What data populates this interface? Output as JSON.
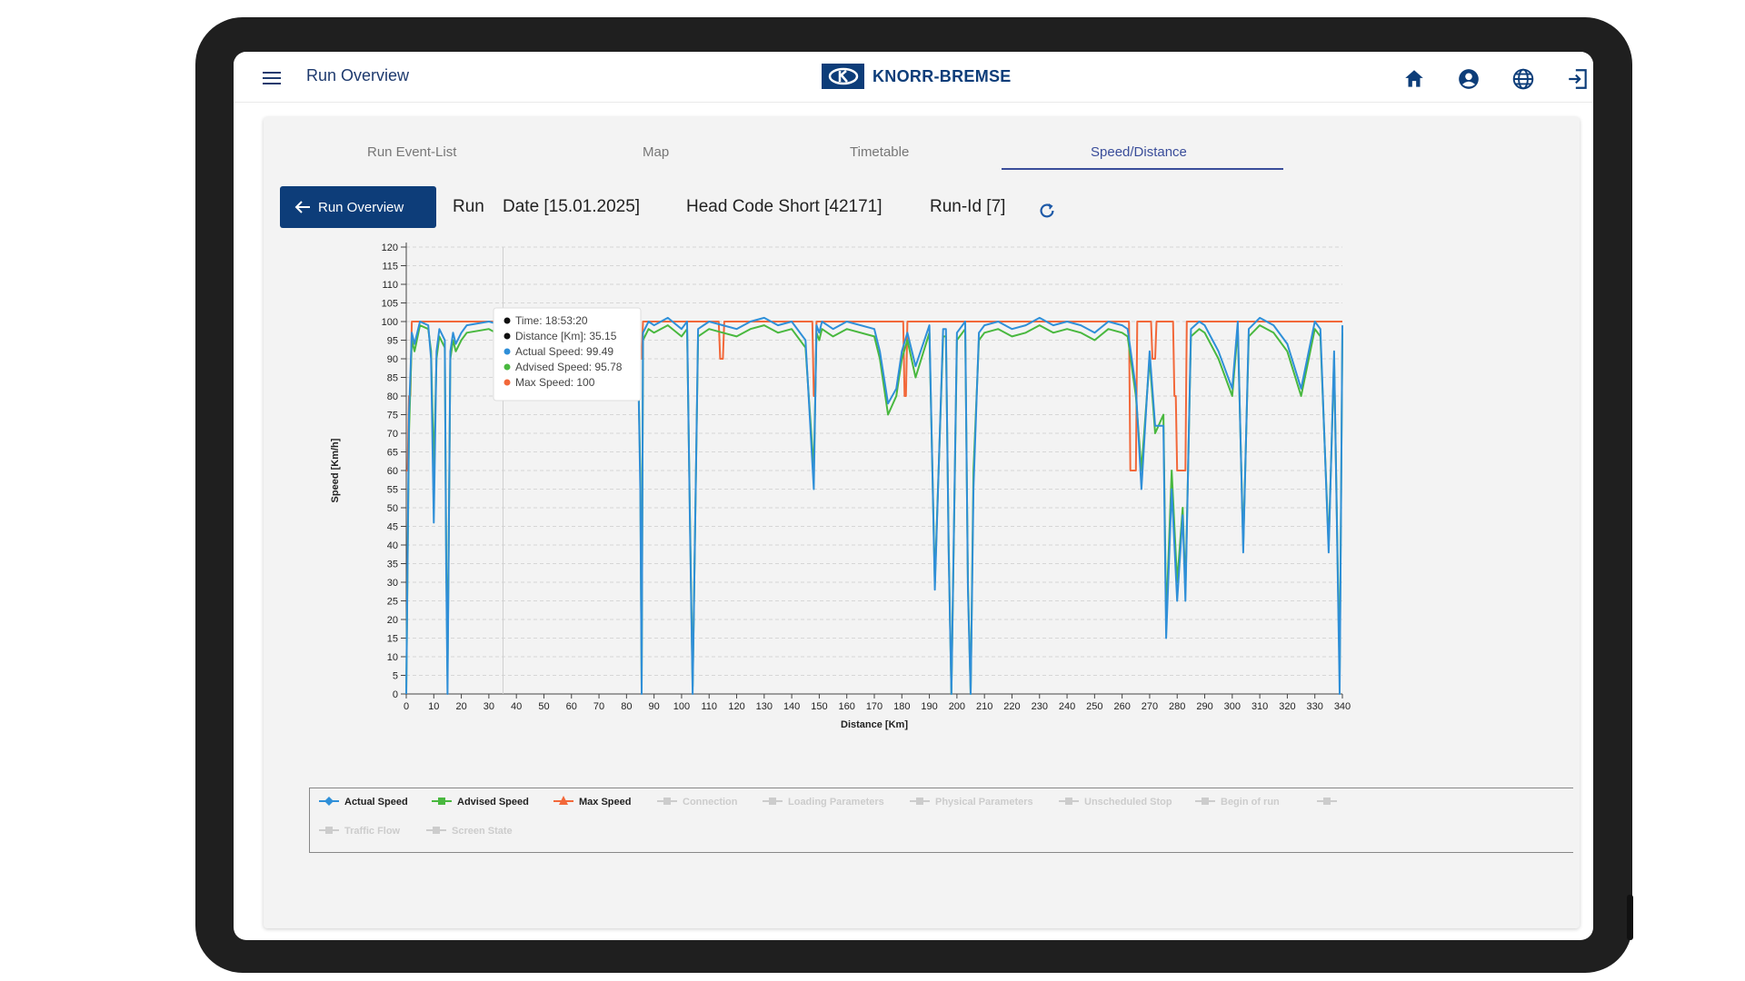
{
  "header": {
    "title": "Run Overview",
    "logo_text": "KNORR-BREMSE"
  },
  "tabs": [
    {
      "label": "Run Event-List"
    },
    {
      "label": "Map"
    },
    {
      "label": "Timetable"
    },
    {
      "label": "Speed/Distance",
      "active": true
    }
  ],
  "back_button": {
    "label": "Run Overview"
  },
  "run_info": {
    "run": "Run",
    "date": "Date [15.01.2025]",
    "head_code": "Head Code Short [42171]",
    "run_id": "Run-Id [7]"
  },
  "colors": {
    "brand": "#0d3d79",
    "actual": "#2f8fd8",
    "advised": "#49b83f",
    "max": "#f2683a"
  },
  "tooltip": {
    "time": "Time: 18:53:20",
    "distance": "Distance [Km]: 35.15",
    "actual": "Actual Speed: 99.49",
    "advised": "Advised Speed: 95.78",
    "max": "Max Speed: 100"
  },
  "legend": [
    {
      "label": "Actual Speed",
      "active": true,
      "marker": "diamond"
    },
    {
      "label": "Advised Speed",
      "active": true,
      "marker": "square"
    },
    {
      "label": "Max Speed",
      "active": true,
      "marker": "triangle"
    },
    {
      "label": "Connection",
      "active": false,
      "marker": "square"
    },
    {
      "label": "Loading Parameters",
      "active": false,
      "marker": "square"
    },
    {
      "label": "Physical Parameters",
      "active": false,
      "marker": "square"
    },
    {
      "label": "Unscheduled Stop",
      "active": false,
      "marker": "square"
    },
    {
      "label": "Begin of run",
      "active": false,
      "marker": "square"
    },
    {
      "label": "",
      "active": false,
      "marker": "square"
    },
    {
      "label": "Traffic Flow",
      "active": false,
      "marker": "square"
    },
    {
      "label": "Screen State",
      "active": false,
      "marker": "square"
    }
  ],
  "chart_data": {
    "type": "line",
    "xlabel": "Distance [Km]",
    "ylabel": "Speed [Km/h]",
    "xlim": [
      0,
      340
    ],
    "ylim": [
      0,
      120
    ],
    "x_ticks": [
      0,
      10,
      20,
      30,
      40,
      50,
      60,
      70,
      80,
      90,
      100,
      110,
      120,
      130,
      140,
      150,
      160,
      170,
      180,
      190,
      200,
      210,
      220,
      230,
      240,
      250,
      260,
      270,
      280,
      290,
      300,
      310,
      320,
      330,
      340
    ],
    "y_ticks": [
      0,
      5,
      10,
      15,
      20,
      25,
      30,
      35,
      40,
      45,
      50,
      55,
      60,
      65,
      70,
      75,
      80,
      85,
      90,
      95,
      100,
      105,
      110,
      115,
      120
    ],
    "grid": true,
    "series": [
      {
        "name": "Max Speed",
        "color": "#f2683a",
        "x": [
          0,
          0.5,
          1,
          1.5,
          2,
          2.5,
          3,
          84,
          84.5,
          85,
          85.5,
          86,
          113,
          113.5,
          114,
          115,
          115.5,
          116,
          147,
          147.5,
          148,
          148.5,
          149,
          149.5,
          180,
          180.5,
          181,
          181.5,
          182,
          182.5,
          262,
          262.5,
          263,
          265,
          265.5,
          266,
          270,
          270.5,
          271,
          272,
          272.5,
          273,
          278,
          278.5,
          279,
          279.5,
          280,
          283,
          283.5,
          284,
          285,
          285.5,
          286,
          340
        ],
        "y": [
          60,
          60,
          80,
          80,
          100,
          100,
          100,
          100,
          100,
          90,
          90,
          100,
          100,
          100,
          90,
          90,
          100,
          100,
          100,
          100,
          80,
          80,
          100,
          100,
          100,
          100,
          80,
          80,
          100,
          100,
          100,
          100,
          60,
          60,
          100,
          100,
          100,
          100,
          90,
          90,
          100,
          100,
          100,
          100,
          80,
          80,
          60,
          60,
          100,
          100,
          100,
          100,
          100,
          100
        ]
      },
      {
        "name": "Advised Speed",
        "color": "#49b83f",
        "x": [
          0,
          1,
          2,
          3,
          5,
          8,
          9,
          10,
          11,
          12,
          14,
          14.5,
          15,
          16,
          17,
          18,
          20,
          22,
          30,
          35,
          40,
          45,
          50,
          55,
          60,
          65,
          70,
          80,
          84,
          85,
          85.5,
          86,
          88,
          90,
          95,
          100,
          102,
          103,
          104,
          106,
          110,
          115,
          120,
          125,
          130,
          135,
          140,
          145,
          148,
          149,
          150,
          151,
          153,
          155,
          160,
          170,
          172,
          175,
          178,
          180,
          182,
          185,
          190,
          192,
          195,
          196,
          197,
          198,
          200,
          203,
          204,
          205,
          206,
          208,
          210,
          215,
          220,
          225,
          230,
          235,
          240,
          245,
          250,
          255,
          260,
          262,
          265,
          267,
          270,
          272,
          275,
          276,
          278,
          280,
          282,
          283,
          285,
          288,
          290,
          295,
          300,
          302,
          304,
          306,
          310,
          315,
          320,
          325,
          330,
          332,
          335,
          337,
          339,
          340
        ],
        "y": [
          0,
          70,
          95,
          92,
          99,
          98,
          92,
          60,
          90,
          96,
          93,
          40,
          5,
          90,
          95,
          92,
          95,
          97,
          98,
          96,
          99,
          98,
          97,
          96,
          98,
          97,
          95,
          97,
          96,
          60,
          2,
          95,
          98,
          97,
          99,
          96,
          98,
          50,
          2,
          96,
          98,
          97,
          96,
          98,
          99,
          97,
          98,
          93,
          60,
          97,
          95,
          98,
          97,
          96,
          98,
          96,
          90,
          75,
          80,
          90,
          95,
          85,
          97,
          30,
          96,
          96,
          40,
          0,
          95,
          98,
          30,
          0,
          60,
          95,
          97,
          98,
          96,
          97,
          99,
          97,
          98,
          97,
          95,
          98,
          97,
          96,
          80,
          60,
          90,
          70,
          75,
          20,
          60,
          30,
          50,
          28,
          96,
          98,
          97,
          90,
          80,
          98,
          40,
          96,
          99,
          97,
          92,
          80,
          98,
          96,
          40,
          90,
          5,
          97
        ]
      },
      {
        "name": "Actual Speed",
        "color": "#2f8fd8",
        "x": [
          0,
          1,
          2,
          3,
          5,
          8,
          9,
          10,
          11,
          12,
          14,
          14.5,
          15,
          16,
          17,
          18,
          20,
          22,
          30,
          35,
          40,
          45,
          50,
          55,
          60,
          65,
          70,
          80,
          84,
          85,
          85.5,
          86,
          88,
          90,
          95,
          100,
          102,
          103,
          104,
          106,
          110,
          115,
          120,
          125,
          130,
          135,
          140,
          145,
          148,
          149,
          150,
          151,
          153,
          155,
          160,
          170,
          172,
          175,
          178,
          180,
          182,
          185,
          190,
          192,
          195,
          196,
          197,
          198,
          200,
          203,
          204,
          205,
          206,
          208,
          210,
          215,
          220,
          225,
          230,
          235,
          240,
          245,
          250,
          255,
          260,
          262,
          265,
          267,
          270,
          272,
          275,
          276,
          278,
          280,
          282,
          283,
          285,
          288,
          290,
          295,
          300,
          302,
          304,
          306,
          310,
          315,
          320,
          325,
          330,
          332,
          335,
          337,
          339,
          340
        ],
        "y": [
          0,
          75,
          97,
          94,
          100,
          99,
          90,
          46,
          92,
          98,
          95,
          35,
          0,
          92,
          97,
          94,
          97,
          99,
          100,
          99,
          101,
          100,
          99,
          98,
          100,
          99,
          97,
          99,
          98,
          55,
          0,
          97,
          100,
          99,
          101,
          98,
          100,
          48,
          0,
          98,
          100,
          99,
          98,
          100,
          101,
          99,
          100,
          95,
          55,
          99,
          97,
          100,
          99,
          98,
          100,
          98,
          92,
          78,
          82,
          92,
          97,
          88,
          99,
          28,
          98,
          98,
          38,
          0,
          97,
          100,
          28,
          0,
          55,
          97,
          99,
          100,
          98,
          99,
          101,
          99,
          100,
          99,
          97,
          100,
          99,
          98,
          82,
          55,
          92,
          72,
          72,
          15,
          55,
          25,
          48,
          25,
          98,
          100,
          99,
          92,
          82,
          100,
          38,
          98,
          101,
          99,
          94,
          82,
          100,
          98,
          38,
          92,
          0,
          99
        ]
      }
    ]
  }
}
